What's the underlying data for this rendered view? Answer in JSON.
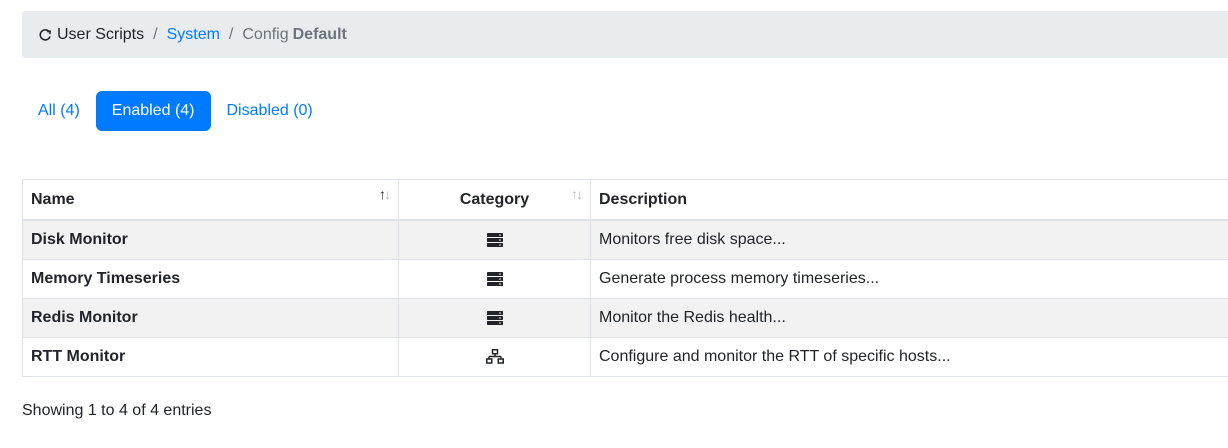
{
  "breadcrumb": {
    "home": "User Scripts",
    "home_icon": "refresh-icon",
    "separator": "/",
    "section": "System",
    "config_label": "Config",
    "config_name": "Default"
  },
  "filters": [
    {
      "label": "All (4)",
      "active": false
    },
    {
      "label": "Enabled (4)",
      "active": true
    },
    {
      "label": "Disabled (0)",
      "active": false
    }
  ],
  "table": {
    "headers": {
      "name": "Name",
      "category": "Category",
      "description": "Description"
    },
    "rows": [
      {
        "name": "Disk Monitor",
        "category_icon": "server-icon",
        "description": "Monitors free disk space..."
      },
      {
        "name": "Memory Timeseries",
        "category_icon": "server-icon",
        "description": "Generate process memory timeseries..."
      },
      {
        "name": "Redis Monitor",
        "category_icon": "server-icon",
        "description": "Monitor the Redis health..."
      },
      {
        "name": "RTT Monitor",
        "category_icon": "network-icon",
        "description": "Configure and monitor the RTT of specific hosts..."
      }
    ]
  },
  "info": "Showing 1 to 4 of 4 entries",
  "colors": {
    "accent": "#007bff",
    "breadcrumb_bg": "#e9ecef",
    "stripe": "#f2f2f2",
    "border": "#dee2e6"
  }
}
